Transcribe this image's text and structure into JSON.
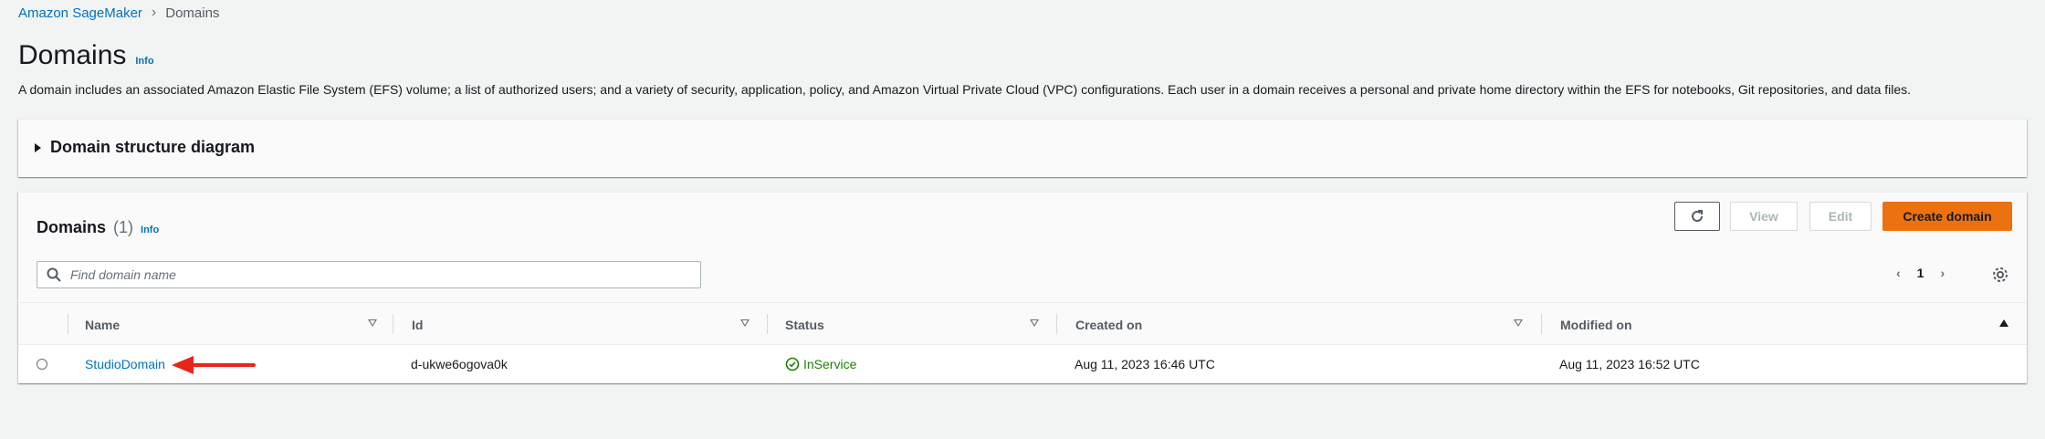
{
  "breadcrumb": {
    "root": "Amazon SageMaker",
    "current": "Domains"
  },
  "page": {
    "title": "Domains",
    "info": "Info",
    "description": "A domain includes an associated Amazon Elastic File System (EFS) volume; a list of authorized users; and a variety of security, application, policy, and Amazon Virtual Private Cloud (VPC) configurations. Each user in a domain receives a personal and private home directory within the EFS for notebooks, Git repositories, and data files."
  },
  "expander": {
    "label": "Domain structure diagram"
  },
  "domains": {
    "title": "Domains",
    "count": "(1)",
    "info": "Info",
    "buttons": {
      "view": "View",
      "edit": "Edit",
      "create": "Create domain"
    },
    "search": {
      "placeholder": "Find domain name",
      "value": ""
    },
    "pager": {
      "page": "1"
    },
    "columns": {
      "name": "Name",
      "id": "Id",
      "status": "Status",
      "created": "Created on",
      "modified": "Modified on"
    },
    "rows": [
      {
        "name": "StudioDomain",
        "id": "d-ukwe6ogova0k",
        "status": "InService",
        "created": "Aug 11, 2023 16:46 UTC",
        "modified": "Aug 11, 2023 16:52 UTC"
      }
    ]
  },
  "colors": {
    "link": "#0073bb",
    "primary": "#ec7211",
    "success": "#1d8102",
    "annotation_arrow": "#e8251a"
  },
  "icons": [
    "chevron-right-icon",
    "caret-right-icon",
    "refresh-icon",
    "search-icon",
    "chevron-left-icon",
    "settings-icon",
    "sort-icon",
    "status-success-icon",
    "red-arrow-annotation"
  ]
}
